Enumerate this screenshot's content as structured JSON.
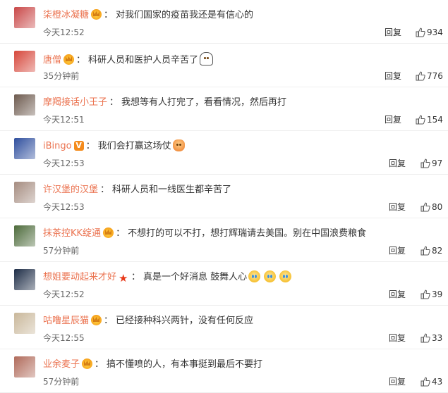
{
  "comments": [
    {
      "user": "柒橙冰凝糖",
      "badge": "crown",
      "text": "对我们国家的疫苗我还是有信心的",
      "emoji": [],
      "time": "今天12:52",
      "reply": "回复",
      "likes": "934",
      "avatar_color": "#c94848"
    },
    {
      "user": "唐僧",
      "badge": "crown",
      "text": "科研人员和医护人员辛苦了",
      "emoji": [
        "ghost"
      ],
      "time": "35分钟前",
      "reply": "回复",
      "likes": "776",
      "avatar_color": "#d6463a"
    },
    {
      "user": "摩羯接话小王子",
      "badge": "",
      "text": "我想等有人打完了，看看情况，然后再打",
      "emoji": [],
      "time": "今天12:51",
      "reply": "回复",
      "likes": "154",
      "avatar_color": "#6d5a4e"
    },
    {
      "user": "iBingo",
      "badge": "vip",
      "text": "我们会打赢这场仗",
      "emoji": [
        "blessing"
      ],
      "time": "今天12:53",
      "reply": "回复",
      "likes": "97",
      "avatar_color": "#2f4f9e"
    },
    {
      "user": "许汉堡的汉堡",
      "badge": "",
      "text": "科研人员和一线医生都辛苦了",
      "emoji": [],
      "time": "今天12:53",
      "reply": "回复",
      "likes": "80",
      "avatar_color": "#a58c80"
    },
    {
      "user": "抹茶控KK绽通",
      "badge": "crown",
      "text": "不想打的可以不打，想打辉瑞请去美国。别在中国浪费粮食",
      "emoji": [],
      "time": "57分钟前",
      "reply": "回复",
      "likes": "82",
      "avatar_color": "#4c6a3a"
    },
    {
      "user": "想姐要动起来才好",
      "badge": "star",
      "text": "真是一个好消息 鼓舞人心",
      "emoji": [
        "cry",
        "cry",
        "cry"
      ],
      "time": "今天12:52",
      "reply": "回复",
      "likes": "39",
      "avatar_color": "#1d2c46"
    },
    {
      "user": "咕噜星辰猫",
      "badge": "crown",
      "text": "已经接种科兴两针，没有任何反应",
      "emoji": [],
      "time": "今天12:55",
      "reply": "回复",
      "likes": "33",
      "avatar_color": "#c9b79a"
    },
    {
      "user": "业余麦子",
      "badge": "crown",
      "text": "搞不懂喷的人，有本事挺到最后不要打",
      "emoji": [],
      "time": "57分钟前",
      "reply": "回复",
      "likes": "43",
      "avatar_color": "#b06a5a"
    }
  ],
  "colors": {
    "username": "#eb7350",
    "text": "#333333",
    "meta": "#666666"
  }
}
